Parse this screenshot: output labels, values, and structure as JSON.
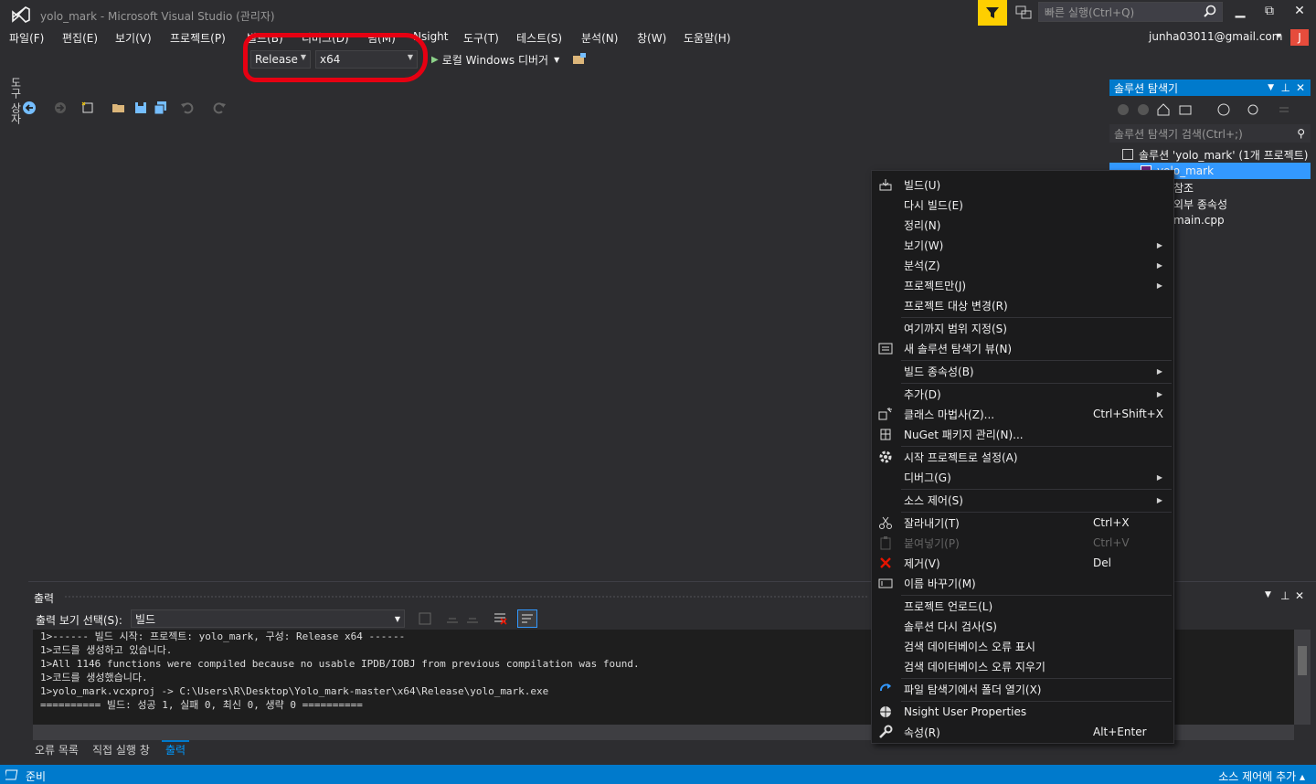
{
  "window": {
    "title": "yolo_mark - Microsoft Visual Studio  (관리자)",
    "quick_launch_placeholder": "빠른 실행(Ctrl+Q)",
    "account": "junha03011@gmail.com",
    "avatar_initial": "J",
    "minimize_glyph": "▁",
    "maximize_glyph": "⧉",
    "close_glyph": "✕"
  },
  "menu": {
    "items": [
      "파일(F)",
      "편집(E)",
      "보기(V)",
      "프로젝트(P)",
      "빌드(B)",
      "디버그(D)",
      "팀(M)",
      "Nsight",
      "도구(T)",
      "테스트(S)",
      "분석(N)",
      "창(W)",
      "도움말(H)"
    ]
  },
  "toolbar": {
    "configuration": "Release",
    "platform": "x64",
    "run_label": "로컬 Windows 디버거",
    "highlight_color": "#e60012"
  },
  "toolbox_tab": "도구 상자",
  "solution_explorer": {
    "title": "솔루션 탐색기",
    "search_placeholder": "솔루션 탐색기 검색(Ctrl+;)",
    "tree": {
      "solution": "솔루션 'yolo_mark' (1개 프로젝트)",
      "project": "yolo_mark",
      "references": "참조",
      "external_deps": "외부 종속성",
      "main_file": "main.cpp"
    }
  },
  "output": {
    "title": "출력",
    "show_from_label": "출력 보기 선택(S):",
    "show_from_value": "빌드",
    "lines": [
      "1>------ 빌드 시작: 프로젝트: yolo_mark, 구성: Release x64 ------",
      "1>코드를 생성하고 있습니다.",
      "1>All 1146 functions were compiled because no usable IPDB/IOBJ from previous compilation was found.",
      "1>코드를 생성했습니다.",
      "1>yolo_mark.vcxproj -> C:\\Users\\R\\Desktop\\Yolo_mark-master\\x64\\Release\\yolo_mark.exe",
      "========== 빌드: 성공 1, 실패 0, 최신 0, 생략 0 =========="
    ]
  },
  "bottom_tabs": [
    "오류 목록",
    "직접 실행 창",
    "출력"
  ],
  "status": {
    "ready": "준비",
    "source_control": "소스 제어에 추가 ▴"
  },
  "context_menu": {
    "items": [
      {
        "label": "빌드(U)",
        "icon": "build-icon"
      },
      {
        "label": "다시 빌드(E)"
      },
      {
        "label": "정리(N)"
      },
      {
        "label": "보기(W)",
        "submenu": true
      },
      {
        "label": "분석(Z)",
        "submenu": true
      },
      {
        "label": "프로젝트만(J)",
        "submenu": true
      },
      {
        "label": "프로젝트 대상 변경(R)"
      },
      {
        "label": "여기까지 범위 지정(S)"
      },
      {
        "label": "새 솔루션 탐색기 뷰(N)",
        "icon": "new-view-icon"
      },
      {
        "label": "빌드 종속성(B)",
        "submenu": true
      },
      {
        "label": "추가(D)",
        "submenu": true
      },
      {
        "label": "클래스 마법사(Z)...",
        "shortcut": "Ctrl+Shift+X",
        "icon": "class-wizard-icon"
      },
      {
        "label": "NuGet 패키지 관리(N)...",
        "icon": "nuget-icon"
      },
      {
        "label": "시작 프로젝트로 설정(A)",
        "icon": "gear-icon"
      },
      {
        "label": "디버그(G)",
        "submenu": true
      },
      {
        "label": "소스 제어(S)",
        "submenu": true
      },
      {
        "label": "잘라내기(T)",
        "shortcut": "Ctrl+X",
        "icon": "cut-icon"
      },
      {
        "label": "붙여넣기(P)",
        "shortcut": "Ctrl+V",
        "icon": "paste-icon",
        "disabled": true
      },
      {
        "label": "제거(V)",
        "shortcut": "Del",
        "icon": "delete-icon"
      },
      {
        "label": "이름 바꾸기(M)",
        "icon": "rename-icon"
      },
      {
        "label": "프로젝트 언로드(L)"
      },
      {
        "label": "솔루션 다시 검사(S)"
      },
      {
        "label": "검색 데이터베이스 오류 표시"
      },
      {
        "label": "검색 데이터베이스 오류 지우기"
      },
      {
        "label": "파일 탐색기에서 폴더 열기(X)",
        "icon": "open-folder-icon"
      },
      {
        "label": "Nsight User Properties",
        "icon": "globe-icon"
      },
      {
        "label": "속성(R)",
        "shortcut": "Alt+Enter",
        "icon": "wrench-icon"
      }
    ]
  },
  "colors": {
    "accent": "#007acc",
    "background": "#2d2d30",
    "menu_bg": "#1b1b1c",
    "filter_yellow": "#fecf00"
  }
}
